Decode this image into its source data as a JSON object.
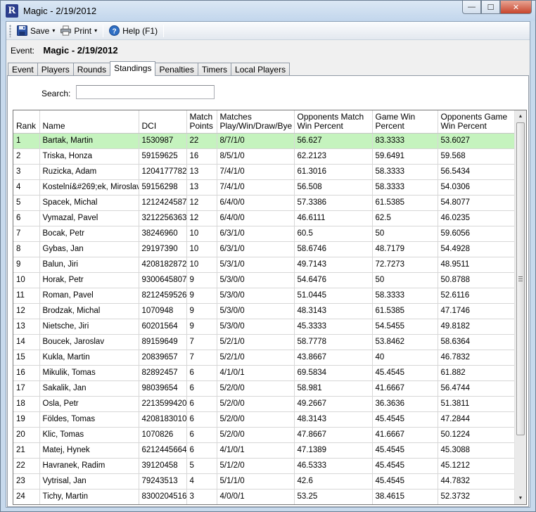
{
  "window": {
    "title": "Magic - 2/19/2012",
    "app_icon_letter": "R",
    "minimize_glyph": "—",
    "maximize_glyph": "☐",
    "close_glyph": "✕"
  },
  "toolbar": {
    "save_label": "Save",
    "print_label": "Print",
    "help_label": "Help (F1)",
    "caret": "▾"
  },
  "event": {
    "label": "Event:",
    "value": "Magic - 2/19/2012"
  },
  "tabs": [
    {
      "label": "Event",
      "active": false
    },
    {
      "label": "Players",
      "active": false
    },
    {
      "label": "Rounds",
      "active": false
    },
    {
      "label": "Standings",
      "active": true
    },
    {
      "label": "Penalties",
      "active": false
    },
    {
      "label": "Timers",
      "active": false
    },
    {
      "label": "Local Players",
      "active": false
    }
  ],
  "search": {
    "label": "Search:",
    "value": ""
  },
  "grid": {
    "columns": [
      {
        "label": "Rank"
      },
      {
        "label": "Name"
      },
      {
        "label": "DCI"
      },
      {
        "label": "Match Points"
      },
      {
        "label": "Matches Play/Win/Draw/Bye"
      },
      {
        "label": "Opponents Match Win Percent"
      },
      {
        "label": "Game Win Percent"
      },
      {
        "label": "Opponents Game Win Percent"
      }
    ],
    "selected_row": 0,
    "rows": [
      [
        "1",
        "Bartak, Martin",
        "1530987",
        "22",
        "8/7/1/0",
        "56.627",
        "83.3333",
        "53.6027"
      ],
      [
        "2",
        "Triska, Honza",
        "59159625",
        "16",
        "8/5/1/0",
        "62.2123",
        "59.6491",
        "59.568"
      ],
      [
        "3",
        "Ruzicka, Adam",
        "1204177782",
        "13",
        "7/4/1/0",
        "61.3016",
        "58.3333",
        "56.5434"
      ],
      [
        "4",
        "Kostelní&#269;ek, Miroslav",
        "59156298",
        "13",
        "7/4/1/0",
        "56.508",
        "58.3333",
        "54.0306"
      ],
      [
        "5",
        "Spacek, Michal",
        "1212424587",
        "12",
        "6/4/0/0",
        "57.3386",
        "61.5385",
        "54.8077"
      ],
      [
        "6",
        "Vymazal, Pavel",
        "3212256363",
        "12",
        "6/4/0/0",
        "46.6111",
        "62.5",
        "46.0235"
      ],
      [
        "7",
        "Bocak, Petr",
        "38246960",
        "10",
        "6/3/1/0",
        "60.5",
        "50",
        "59.6056"
      ],
      [
        "8",
        "Gybas, Jan",
        "29197390",
        "10",
        "6/3/1/0",
        "58.6746",
        "48.7179",
        "54.4928"
      ],
      [
        "9",
        "Balun, Jiri",
        "4208182872",
        "10",
        "5/3/1/0",
        "49.7143",
        "72.7273",
        "48.9511"
      ],
      [
        "10",
        "Horak, Petr",
        "9300645807",
        "9",
        "5/3/0/0",
        "54.6476",
        "50",
        "50.8788"
      ],
      [
        "11",
        "Roman, Pavel",
        "8212459526",
        "9",
        "5/3/0/0",
        "51.0445",
        "58.3333",
        "52.6116"
      ],
      [
        "12",
        "Brodzak, Michal",
        "1070948",
        "9",
        "5/3/0/0",
        "48.3143",
        "61.5385",
        "47.1746"
      ],
      [
        "13",
        "Nietsche, Jiri",
        "60201564",
        "9",
        "5/3/0/0",
        "45.3333",
        "54.5455",
        "49.8182"
      ],
      [
        "14",
        "Boucek, Jaroslav",
        "89159649",
        "7",
        "5/2/1/0",
        "58.7778",
        "53.8462",
        "58.6364"
      ],
      [
        "15",
        "Kukla, Martin",
        "20839657",
        "7",
        "5/2/1/0",
        "43.8667",
        "40",
        "46.7832"
      ],
      [
        "16",
        "Mikulik, Tomas",
        "82892457",
        "6",
        "4/1/0/1",
        "69.5834",
        "45.4545",
        "61.882"
      ],
      [
        "17",
        "Sakalik, Jan",
        "98039654",
        "6",
        "5/2/0/0",
        "58.981",
        "41.6667",
        "56.4744"
      ],
      [
        "18",
        "Osla, Petr",
        "2213599420",
        "6",
        "5/2/0/0",
        "49.2667",
        "36.3636",
        "51.3811"
      ],
      [
        "19",
        "Földes, Tomas",
        "4208183010",
        "6",
        "5/2/0/0",
        "48.3143",
        "45.4545",
        "47.2844"
      ],
      [
        "20",
        "Klic, Tomas",
        "1070826",
        "6",
        "5/2/0/0",
        "47.8667",
        "41.6667",
        "50.1224"
      ],
      [
        "21",
        "Matej, Hynek",
        "6212445664",
        "6",
        "4/1/0/1",
        "47.1389",
        "45.4545",
        "45.3088"
      ],
      [
        "22",
        "Havranek, Radim",
        "39120458",
        "5",
        "5/1/2/0",
        "46.5333",
        "45.4545",
        "45.1212"
      ],
      [
        "23",
        "Vytrisal, Jan",
        "79243513",
        "4",
        "5/1/1/0",
        "42.6",
        "45.4545",
        "44.7832"
      ],
      [
        "24",
        "Tichy, Martin",
        "8300204516",
        "3",
        "4/0/0/1",
        "53.25",
        "38.4615",
        "52.3732"
      ]
    ]
  },
  "scrollbar": {
    "up_glyph": "▲",
    "down_glyph": "▼"
  }
}
